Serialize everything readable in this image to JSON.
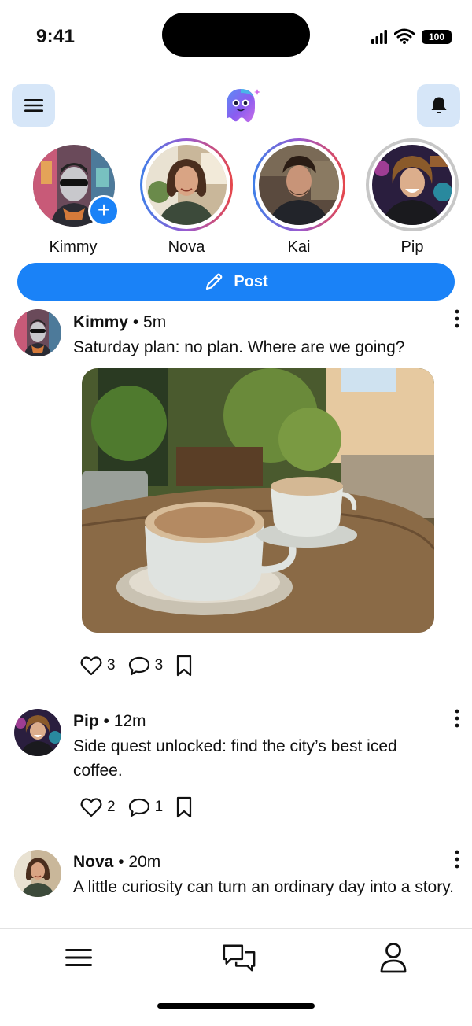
{
  "status_bar": {
    "time": "9:41",
    "battery": "100"
  },
  "header": {
    "menu_icon": "hamburger-icon",
    "logo": "ghost-mascot-logo",
    "bell_icon": "bell-icon"
  },
  "stories": [
    {
      "name": "Kimmy",
      "ring": "none",
      "has_add": true
    },
    {
      "name": "Nova",
      "ring": "gradient"
    },
    {
      "name": "Kai",
      "ring": "gradient"
    },
    {
      "name": "Pip",
      "ring": "gray"
    }
  ],
  "post_button": {
    "label": "Post",
    "icon": "pencil-icon"
  },
  "feed": [
    {
      "author": "Kimmy",
      "time": "• 5m",
      "text": "Saturday plan: no plan. Where are we going?",
      "likes": "3",
      "comments": "3",
      "has_image": true
    },
    {
      "author": "Pip",
      "time": "• 12m",
      "text": "Side quest unlocked: find the city’s best iced coffee.",
      "likes": "2",
      "comments": "1"
    },
    {
      "author": "Nova",
      "time": "• 20m",
      "text": "A little curiosity can turn an ordinary day into a story."
    }
  ],
  "bottom_nav": [
    {
      "icon": "menu-lines-icon"
    },
    {
      "icon": "chat-bubbles-icon"
    },
    {
      "icon": "person-icon"
    }
  ],
  "colors": {
    "accent": "#1a82f7",
    "header_button_bg": "#d6e6f8"
  }
}
